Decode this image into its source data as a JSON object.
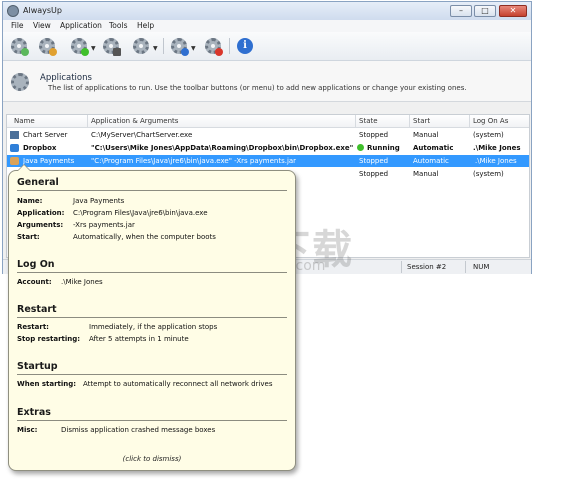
{
  "window": {
    "title": "AlwaysUp"
  },
  "menu": [
    "File",
    "View",
    "Application",
    "Tools",
    "Help"
  ],
  "toolbar": {
    "buttons": [
      "add-application",
      "edit-application",
      "start-application",
      "stop-application",
      "restart-application",
      "report-application",
      "remove-application",
      "help"
    ]
  },
  "header": {
    "title": "Applications",
    "description": "The list of applications to run. Use the toolbar buttons (or menu) to add new applications or change your existing ones."
  },
  "table": {
    "columns": [
      "Name",
      "Application & Arguments",
      "State",
      "Start",
      "Log On As"
    ],
    "rows": [
      {
        "name": "Chart Server",
        "app": "C:\\MyServer\\ChartServer.exe",
        "state": "Stopped",
        "start": "Manual",
        "logon": "(system)"
      },
      {
        "name": "Dropbox",
        "app": "\"C:\\Users\\Mike Jones\\AppData\\Roaming\\Dropbox\\bin\\Dropbox.exe\"",
        "state": "Running",
        "start": "Automatic",
        "logon": ".\\Mike Jones"
      },
      {
        "name": "Java Payments",
        "app": "\"C:\\Program Files\\Java\\jre6\\bin\\java.exe\" -Xrs payments.jar",
        "state": "Stopped",
        "start": "Automatic",
        "logon": ".\\Mike Jones"
      },
      {
        "name": "",
        "app": "",
        "state": "Stopped",
        "start": "Manual",
        "logon": "(system)"
      }
    ]
  },
  "statusbar": {
    "session": "Session #2",
    "num": "NUM"
  },
  "tooltip": {
    "general": {
      "heading": "General",
      "name_label": "Name:",
      "name_value": "Java Payments",
      "application_label": "Application:",
      "application_value": "C:\\Program Files\\Java\\jre6\\bin\\java.exe",
      "arguments_label": "Arguments:",
      "arguments_value": "-Xrs payments.jar",
      "start_label": "Start:",
      "start_value": "Automatically, when the computer boots"
    },
    "logon": {
      "heading": "Log On",
      "account_label": "Account:",
      "account_value": ".\\Mike Jones"
    },
    "restart": {
      "heading": "Restart",
      "restart_label": "Restart:",
      "restart_value": "Immediately, if the application stops",
      "stop_label": "Stop restarting:",
      "stop_value": "After 5 attempts in 1 minute"
    },
    "startup": {
      "heading": "Startup",
      "when_label": "When starting:",
      "when_value": "Attempt to automatically reconnect all network drives"
    },
    "extras": {
      "heading": "Extras",
      "misc_label": "Misc:",
      "misc_value": "Dismiss application crashed message boxes"
    },
    "dismiss": "(click to dismiss)"
  },
  "watermark": {
    "text": "安下载",
    "sub": "anxz.com"
  },
  "colors": {
    "selection": "#3399ff",
    "tooltip_bg": "#fffde6",
    "running": "#3fbf2b"
  }
}
